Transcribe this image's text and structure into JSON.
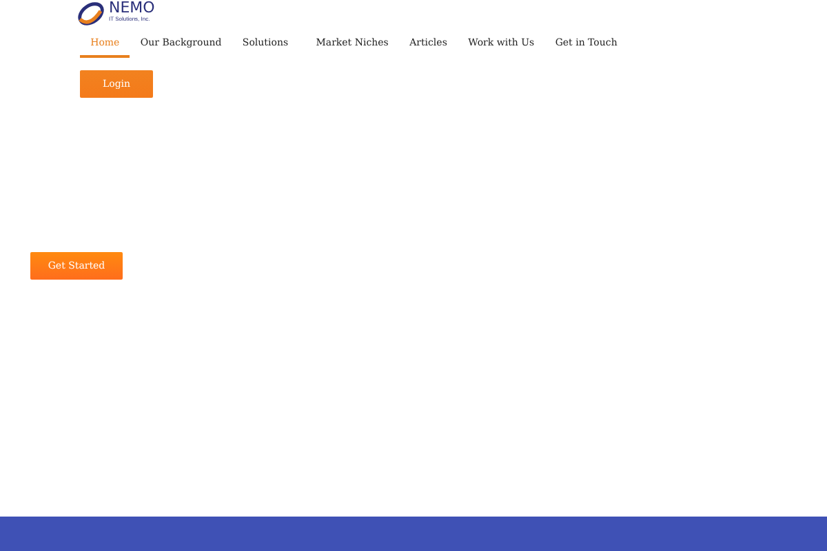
{
  "logo": {
    "name": "NEMO",
    "tagline": "IT Solutions, Inc."
  },
  "nav": [
    {
      "label": "Home",
      "selected": true
    },
    {
      "label": "Our Background",
      "selected": false
    },
    {
      "label": "Solutions",
      "selected": false
    },
    {
      "label": "Market Niches",
      "selected": false
    },
    {
      "label": "Articles",
      "selected": false
    },
    {
      "label": "Work with Us",
      "selected": false
    },
    {
      "label": "Get in Touch",
      "selected": false
    }
  ],
  "login_button": "Login",
  "hero": {
    "button": "Get Started"
  }
}
